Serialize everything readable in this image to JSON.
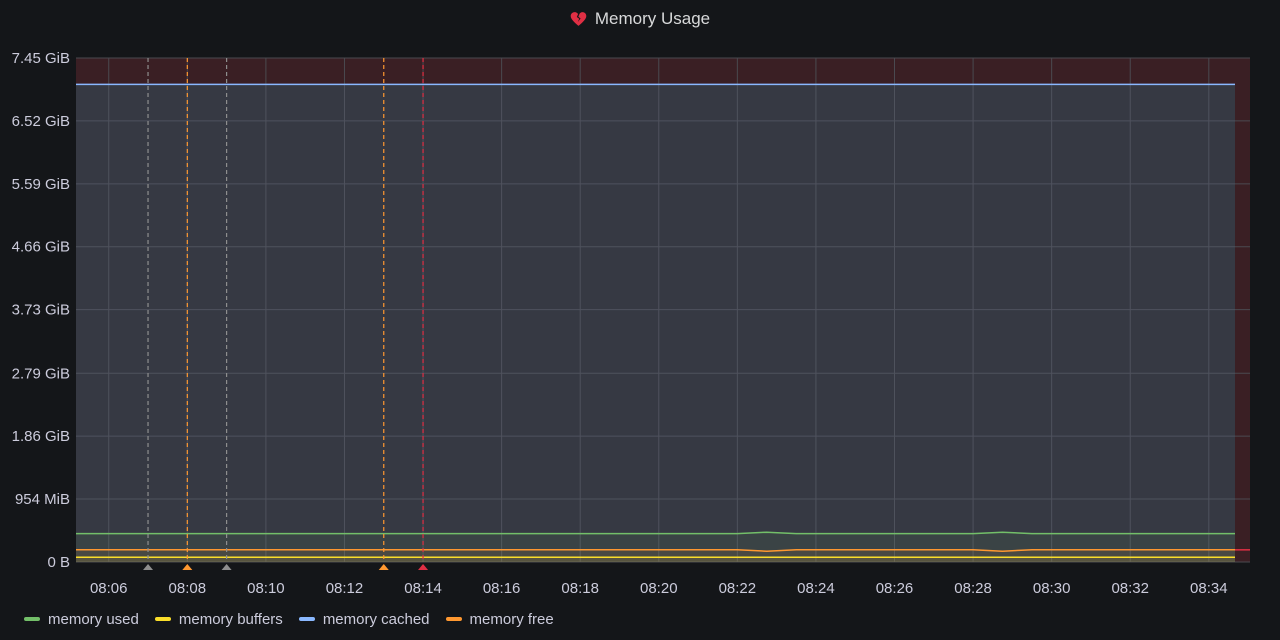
{
  "panel": {
    "title": "Memory Usage",
    "alert_icon": "broken-heart-icon",
    "alert_color": "#e02f44"
  },
  "colors": {
    "background": "#141619",
    "plot_background": "#2f2f34",
    "alert_band": "#3a1f24",
    "grid": "#4a4a50",
    "threshold": "#e02f44"
  },
  "chart_data": {
    "type": "line",
    "title": "Memory Usage",
    "x": [
      "08:06",
      "08:08",
      "08:10",
      "08:12",
      "08:14",
      "08:16",
      "08:18",
      "08:20",
      "08:22",
      "08:24",
      "08:26",
      "08:28",
      "08:30",
      "08:32",
      "08:34"
    ],
    "x_range": [
      "08:05:10",
      "08:34:40"
    ],
    "y_ticks": [
      "0 B",
      "954 MiB",
      "1.86 GiB",
      "2.79 GiB",
      "3.73 GiB",
      "4.66 GiB",
      "5.59 GiB",
      "6.52 GiB",
      "7.45 GiB"
    ],
    "y_tick_values_gib": [
      0,
      0.9317,
      1.86,
      2.79,
      3.73,
      4.66,
      5.59,
      6.52,
      7.45
    ],
    "ylim_gib": [
      0,
      7.45
    ],
    "grid": true,
    "legend_position": "bottom-left",
    "threshold_gib": 7.06,
    "series": [
      {
        "name": "memory used",
        "color": "#73bf69",
        "t": [
          "08:05:10",
          "08:10:00",
          "08:15:00",
          "08:20:00",
          "08:22:00",
          "08:22:45",
          "08:23:30",
          "08:26:00",
          "08:28:00",
          "08:28:45",
          "08:29:30",
          "08:32:00",
          "08:34:40"
        ],
        "values": [
          0.42,
          0.42,
          0.42,
          0.42,
          0.42,
          0.44,
          0.42,
          0.42,
          0.42,
          0.44,
          0.42,
          0.42,
          0.42
        ]
      },
      {
        "name": "memory buffers",
        "color": "#fade2a",
        "t": [
          "08:05:10",
          "08:34:40"
        ],
        "values": [
          0.07,
          0.07
        ]
      },
      {
        "name": "memory cached",
        "color": "#8ab8ff",
        "t": [
          "08:05:10",
          "08:34:40"
        ],
        "values": [
          7.06,
          7.06
        ]
      },
      {
        "name": "memory free",
        "color": "#ff9830",
        "t": [
          "08:05:10",
          "08:22:00",
          "08:22:45",
          "08:23:30",
          "08:28:00",
          "08:28:45",
          "08:29:30",
          "08:34:40"
        ],
        "values": [
          0.18,
          0.18,
          0.16,
          0.18,
          0.18,
          0.16,
          0.18,
          0.18
        ]
      }
    ],
    "annotations": [
      {
        "time": "08:07:00",
        "color": "#8e8e8e"
      },
      {
        "time": "08:08:00",
        "color": "#ff9830"
      },
      {
        "time": "08:09:00",
        "color": "#8e8e8e"
      },
      {
        "time": "08:13:00",
        "color": "#ff9830"
      },
      {
        "time": "08:14:00",
        "color": "#e02f44"
      }
    ]
  }
}
